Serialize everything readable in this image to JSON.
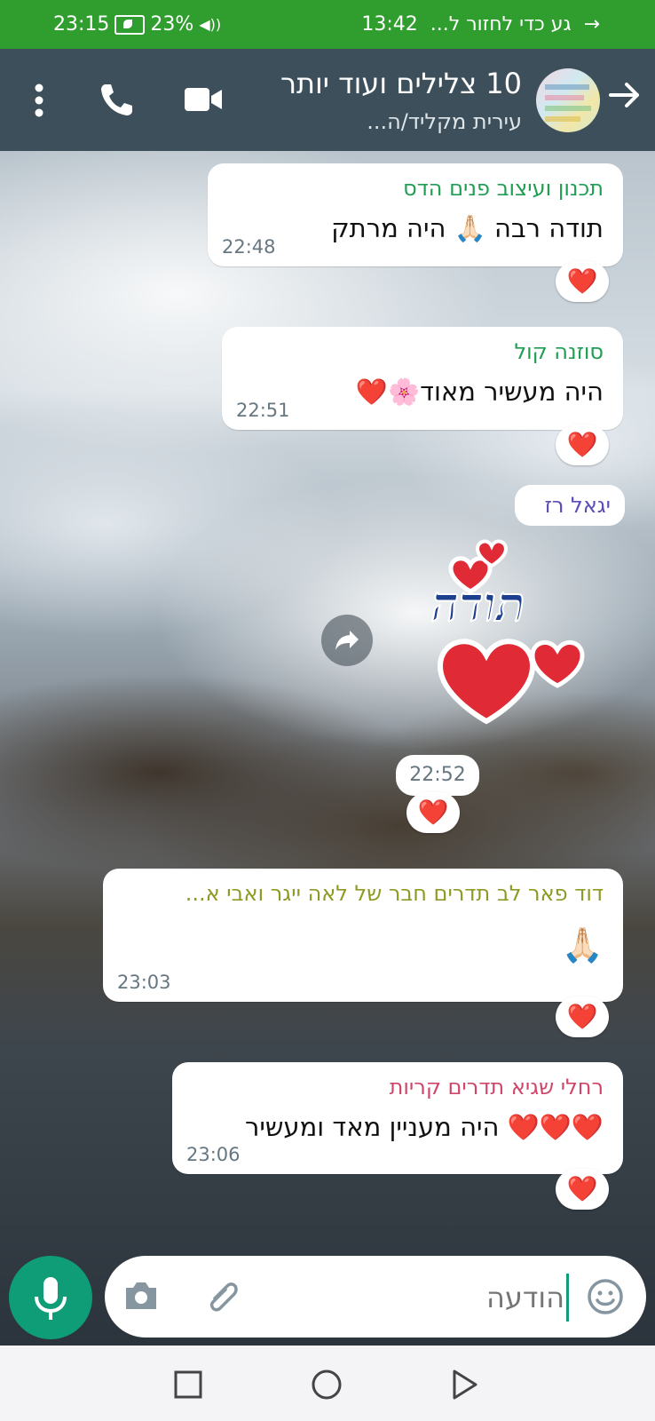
{
  "status_bar": {
    "time": "23:15",
    "battery": "23%",
    "return_call": "גע כדי לחזור ל...",
    "call_time": "13:42"
  },
  "header": {
    "title": "10 צלילים ועוד יותר",
    "subtitle": "עירית מקליד/ה..."
  },
  "messages": [
    {
      "sender": "תכנון ועיצוב פנים הדס",
      "sender_color": "#1f9e54",
      "text": "תודה רבה 🙏🏻 היה מרתק",
      "time": "22:48",
      "reaction": "❤️"
    },
    {
      "sender": "סוזנה קול",
      "sender_color": "#1f9e54",
      "text": "היה מעשיר מאוד🌸❤️",
      "time": "22:51",
      "reaction": "❤️"
    },
    {
      "sender": "דוד פאר לב תדרים חבר של לאה ייגר ואבי א...",
      "sender_color": "#8f9a24",
      "text": "🙏🏻",
      "time": "23:03",
      "reaction": "❤️"
    },
    {
      "sender": "רחלי שגיא תדרים קריות",
      "sender_color": "#d0466a",
      "text": "❤️❤️❤️ היה מעניין מאד ומעשיר",
      "time": "23:06",
      "reaction": "❤️"
    }
  ],
  "sticker_message": {
    "sender": "יגאל רז",
    "sender_color": "#5b4db8",
    "sticker_text": "תודה",
    "time": "22:52",
    "reaction": "❤️"
  },
  "input": {
    "placeholder": "הודעה"
  },
  "icons": {
    "back": "arrow-right-icon",
    "video": "video-call-icon",
    "call": "phone-icon",
    "menu": "more-vert-icon",
    "forward": "forward-icon",
    "camera": "camera-icon",
    "attach": "paperclip-icon",
    "emoji": "emoji-icon",
    "mic": "mic-icon"
  }
}
